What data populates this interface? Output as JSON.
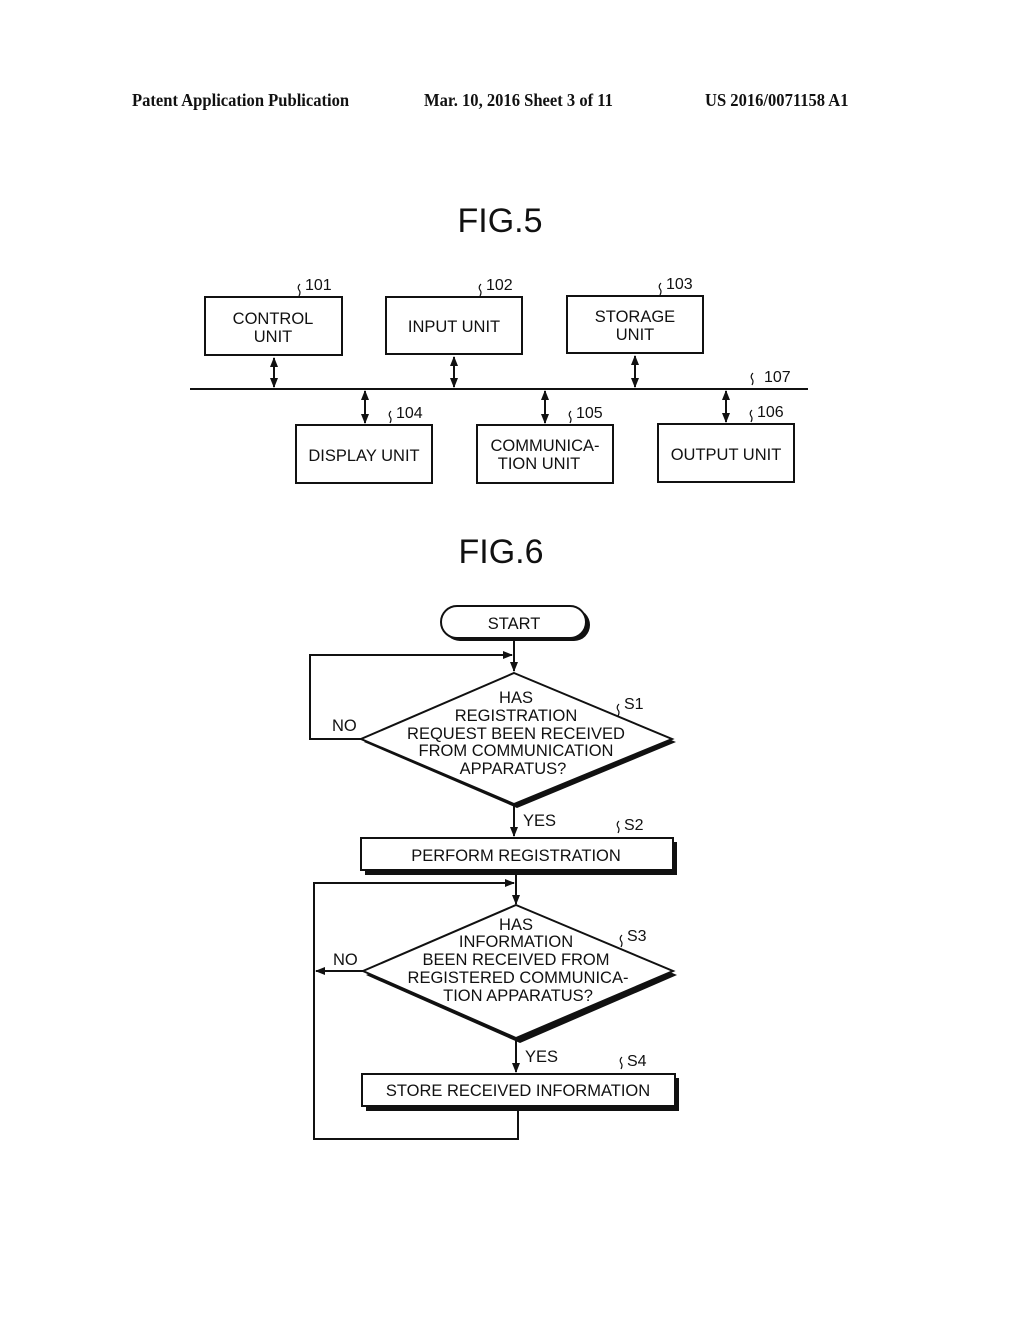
{
  "header": {
    "left": "Patent Application Publication",
    "middle": "Mar. 10, 2016  Sheet 3 of 11",
    "right": "US 2016/0071158 A1"
  },
  "fig5": {
    "title": "FIG.5",
    "bus_ref": "107",
    "blocks": [
      {
        "ref": "101",
        "lines": [
          "CONTROL",
          "UNIT"
        ]
      },
      {
        "ref": "102",
        "lines": [
          "INPUT UNIT"
        ]
      },
      {
        "ref": "103",
        "lines": [
          "STORAGE",
          "UNIT"
        ]
      },
      {
        "ref": "104",
        "lines": [
          "DISPLAY UNIT"
        ]
      },
      {
        "ref": "105",
        "lines": [
          "COMMUNICA-",
          "TION UNIT"
        ]
      },
      {
        "ref": "106",
        "lines": [
          "OUTPUT UNIT"
        ]
      }
    ]
  },
  "fig6": {
    "title": "FIG.6",
    "start": "START",
    "s1": {
      "ref": "S1",
      "lines": [
        "HAS",
        "REGISTRATION",
        "REQUEST BEEN RECEIVED",
        "FROM COMMUNICATION",
        "APPARATUS?"
      ],
      "no": "NO",
      "yes": "YES"
    },
    "s2": {
      "ref": "S2",
      "text": "PERFORM REGISTRATION"
    },
    "s3": {
      "ref": "S3",
      "lines": [
        "HAS",
        "INFORMATION",
        "BEEN RECEIVED FROM",
        "REGISTERED COMMUNICA-",
        "TION APPARATUS?"
      ],
      "no": "NO",
      "yes": "YES"
    },
    "s4": {
      "ref": "S4",
      "text": "STORE RECEIVED INFORMATION"
    }
  }
}
